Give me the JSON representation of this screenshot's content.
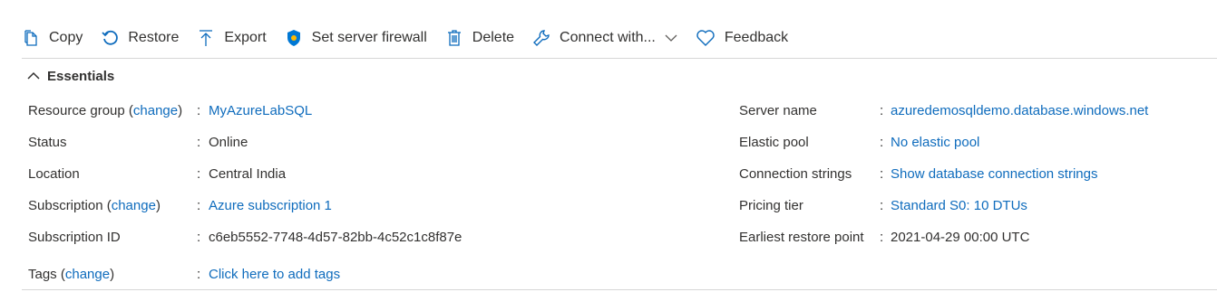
{
  "toolbar": {
    "copy": "Copy",
    "restore": "Restore",
    "export": "Export",
    "firewall": "Set server firewall",
    "delete": "Delete",
    "connect": "Connect with...",
    "feedback": "Feedback"
  },
  "essentials": {
    "title": "Essentials"
  },
  "left": {
    "resource_group": {
      "label": "Resource group",
      "change": "change",
      "value": "MyAzureLabSQL"
    },
    "status": {
      "label": "Status",
      "value": "Online"
    },
    "location": {
      "label": "Location",
      "value": "Central India"
    },
    "subscription": {
      "label": "Subscription",
      "change": "change",
      "value": "Azure subscription 1"
    },
    "subscription_id": {
      "label": "Subscription ID",
      "value": "c6eb5552-7748-4d57-82bb-4c52c1c8f87e"
    },
    "tags": {
      "label": "Tags",
      "change": "change",
      "value": "Click here to add tags"
    }
  },
  "right": {
    "server_name": {
      "label": "Server name",
      "value": "azuredemosqldemo.database.windows.net"
    },
    "elastic_pool": {
      "label": "Elastic pool",
      "value": "No elastic pool"
    },
    "connection_strings": {
      "label": "Connection strings",
      "value": "Show database connection strings"
    },
    "pricing_tier": {
      "label": "Pricing tier",
      "value": "Standard S0: 10 DTUs"
    },
    "restore_point": {
      "label": "Earliest restore point",
      "value": "2021-04-29 00:00 UTC"
    }
  },
  "colors": {
    "link": "#0f6cbd",
    "text": "#323130",
    "shield": "#0078d4",
    "shield_accent": "#ffb900"
  }
}
